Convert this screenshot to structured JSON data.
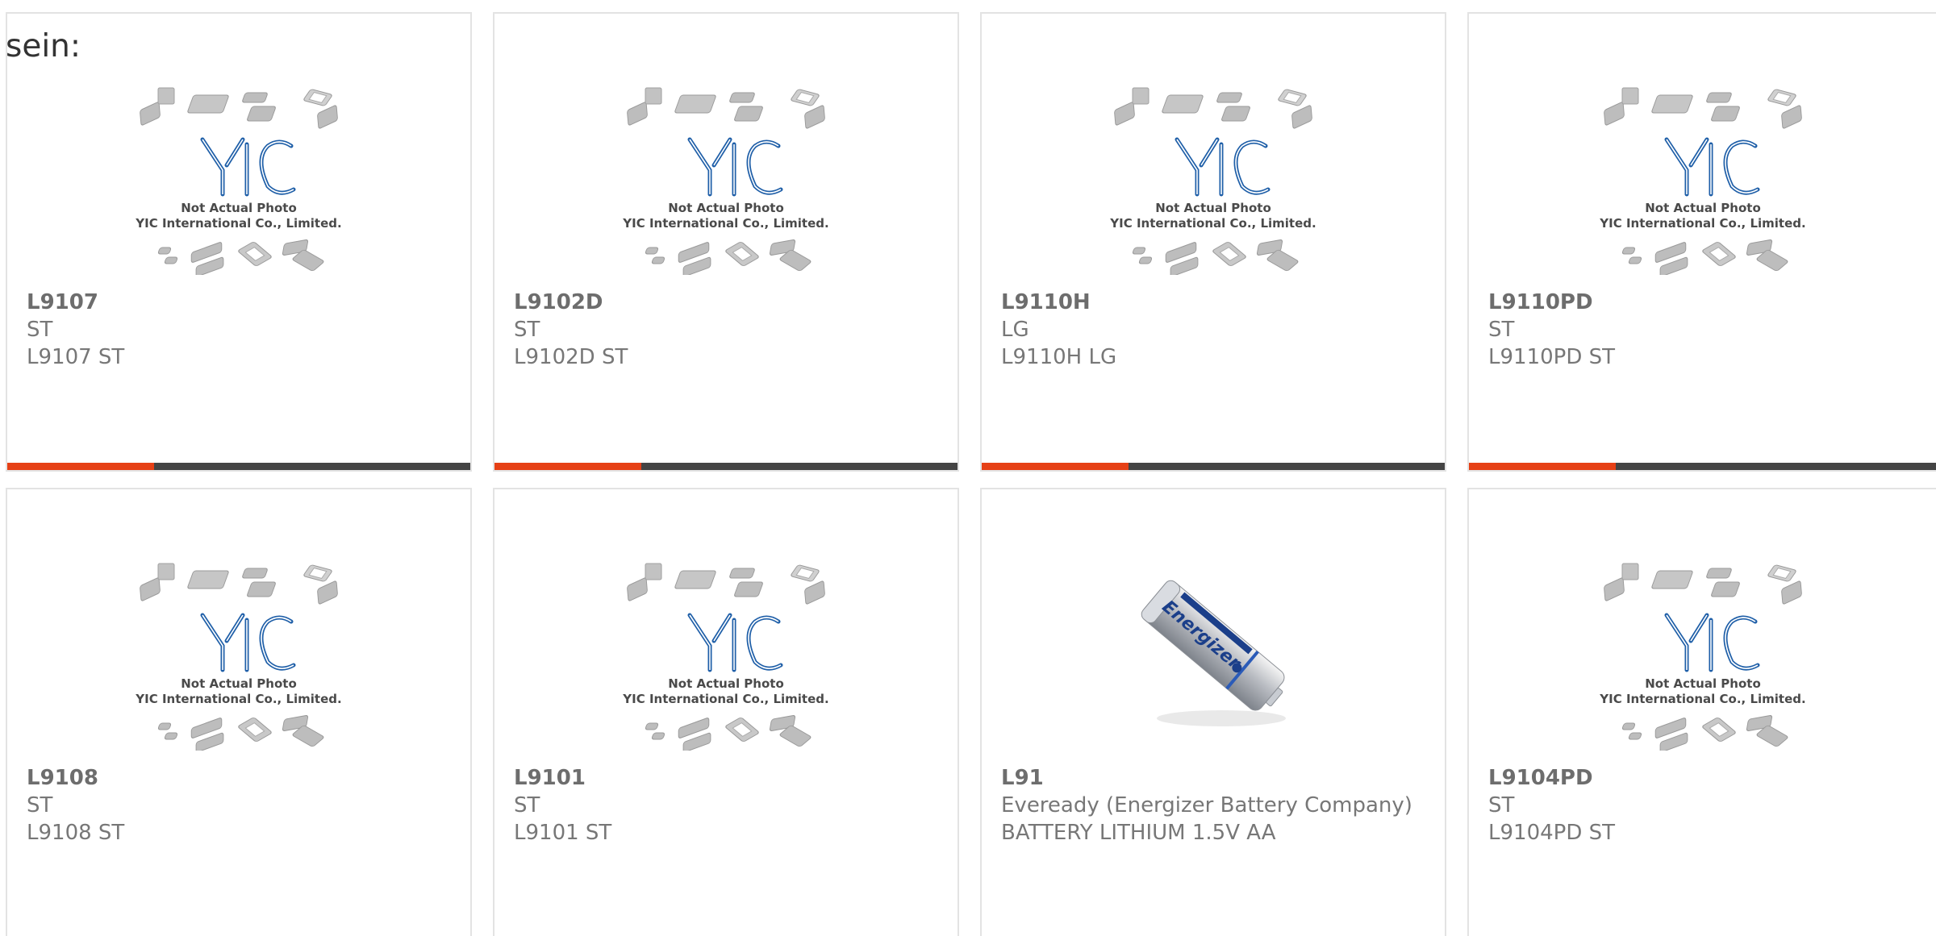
{
  "heading": "sein:",
  "placeholder": {
    "line1": "Not Actual Photo",
    "line2": "YIC International Co., Limited."
  },
  "colors": {
    "accent": "#e64016",
    "bar": "#444444",
    "logo": "#1f5fa8"
  },
  "products": [
    {
      "part": "L9107",
      "maker": "ST",
      "desc": "L9107 ST",
      "image": "yic-placeholder"
    },
    {
      "part": "L9102D",
      "maker": "ST",
      "desc": "L9102D ST",
      "image": "yic-placeholder"
    },
    {
      "part": "L9110H",
      "maker": "LG",
      "desc": "L9110H LG",
      "image": "yic-placeholder"
    },
    {
      "part": "L9110PD",
      "maker": "ST",
      "desc": "L9110PD ST",
      "image": "yic-placeholder"
    },
    {
      "part": "L9108",
      "maker": "ST",
      "desc": "L9108 ST",
      "image": "yic-placeholder"
    },
    {
      "part": "L9101",
      "maker": "ST",
      "desc": "L9101 ST",
      "image": "yic-placeholder"
    },
    {
      "part": "L91",
      "maker": "Eveready (Energizer Battery Company)",
      "desc": "BATTERY LITHIUM 1.5V AA",
      "image": "battery-photo",
      "battery_label": "Energizer"
    },
    {
      "part": "L9104PD",
      "maker": "ST",
      "desc": "L9104PD ST",
      "image": "yic-placeholder"
    }
  ]
}
